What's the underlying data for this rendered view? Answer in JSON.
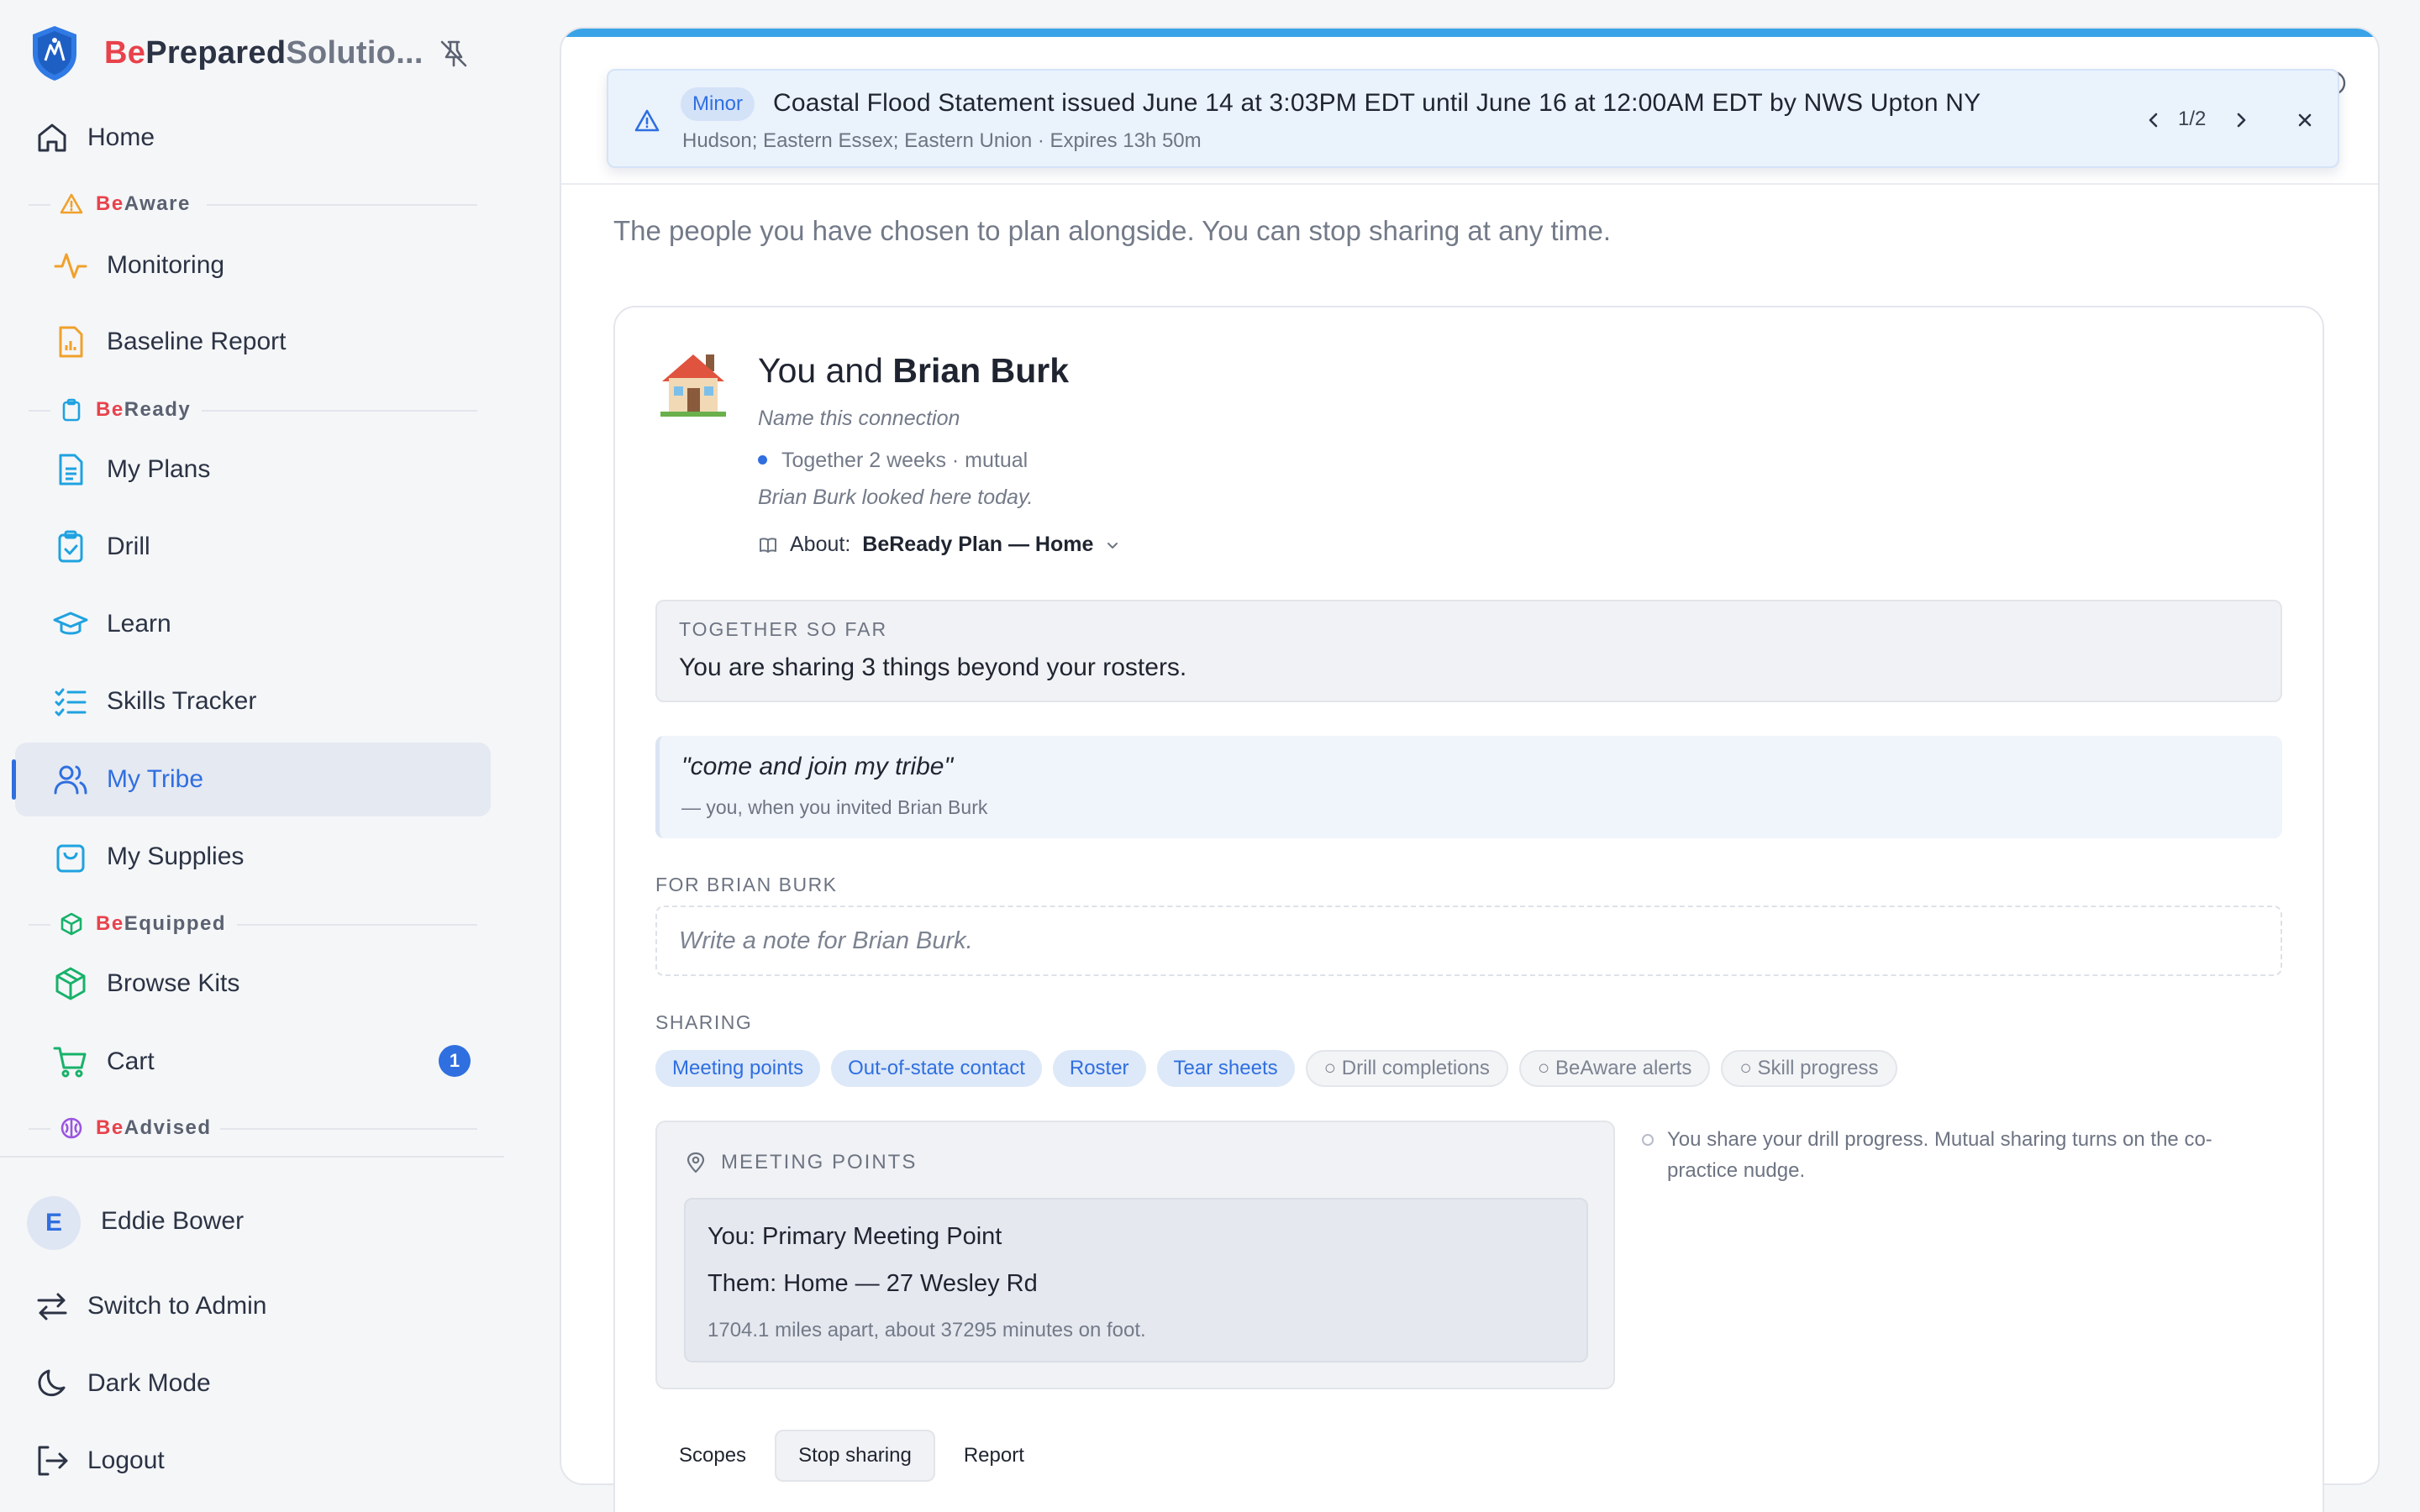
{
  "brand": {
    "be": "Be",
    "prepared": "Prepared",
    "solutions": "Solutio..."
  },
  "nav": {
    "home": "Home",
    "sections": {
      "aware": {
        "be": "Be",
        "rest": "Aware"
      },
      "ready": {
        "be": "Be",
        "rest": "Ready"
      },
      "equipped": {
        "be": "Be",
        "rest": "Equipped"
      },
      "advised": {
        "be": "Be",
        "rest": "Advised"
      }
    },
    "monitoring": "Monitoring",
    "baseline_report": "Baseline Report",
    "my_plans": "My Plans",
    "drill": "Drill",
    "learn": "Learn",
    "skills_tracker": "Skills Tracker",
    "my_tribe": "My Tribe",
    "my_supplies": "My Supplies",
    "browse_kits": "Browse Kits",
    "cart": "Cart",
    "cart_count": "1"
  },
  "user": {
    "initial": "E",
    "name": "Eddie Bower"
  },
  "footer": {
    "switch_admin": "Switch to Admin",
    "dark_mode": "Dark Mode",
    "logout": "Logout"
  },
  "alert": {
    "severity": "Minor",
    "title": "Coastal Flood Statement issued June 14 at 3:03PM EDT until June 16 at 12:00AM EDT by NWS Upton NY",
    "subtitle": "Hudson; Eastern Essex; Eastern Union · Expires 13h 50m",
    "pager": "1/2"
  },
  "intro": "The people you have chosen to plan alongside. You can stop sharing at any time.",
  "connection": {
    "title_prefix": "You and ",
    "partner": "Brian Burk",
    "name_hint": "Name this connection",
    "together": "Together 2 weeks · mutual",
    "looked": "Brian Burk looked here today.",
    "about_label": "About:",
    "about_value": "BeReady Plan — Home",
    "so_far_heading": "TOGETHER SO FAR",
    "so_far_text": "You are sharing 3 things beyond your rosters.",
    "quote": "\"come and join my tribe\"",
    "quote_by": "— you, when you invited Brian Burk",
    "for_heading": "FOR BRIAN BURK",
    "note_placeholder": "Write a note for Brian Burk.",
    "sharing_heading": "SHARING",
    "chips_on": [
      "Meeting points",
      "Out-of-state contact",
      "Roster",
      "Tear sheets"
    ],
    "chips_off": [
      "○ Drill completions",
      "○ BeAware alerts",
      "○ Skill progress"
    ],
    "meeting_points": {
      "heading": "MEETING POINTS",
      "you_label": "You:",
      "you_value": " Primary Meeting Point",
      "them_label": "Them:",
      "them_value": " Home — 27 Wesley Rd",
      "distance": "1704.1 miles apart, about 37295 minutes on foot."
    },
    "aside": "You share your drill progress. Mutual sharing turns on the co-practice nudge.",
    "tabs": [
      "Scopes",
      "Stop sharing",
      "Report"
    ]
  },
  "colors": {
    "accent": "#2f6fe0",
    "brand_red": "#e8424c",
    "top_bar": "#3aa3e8"
  }
}
